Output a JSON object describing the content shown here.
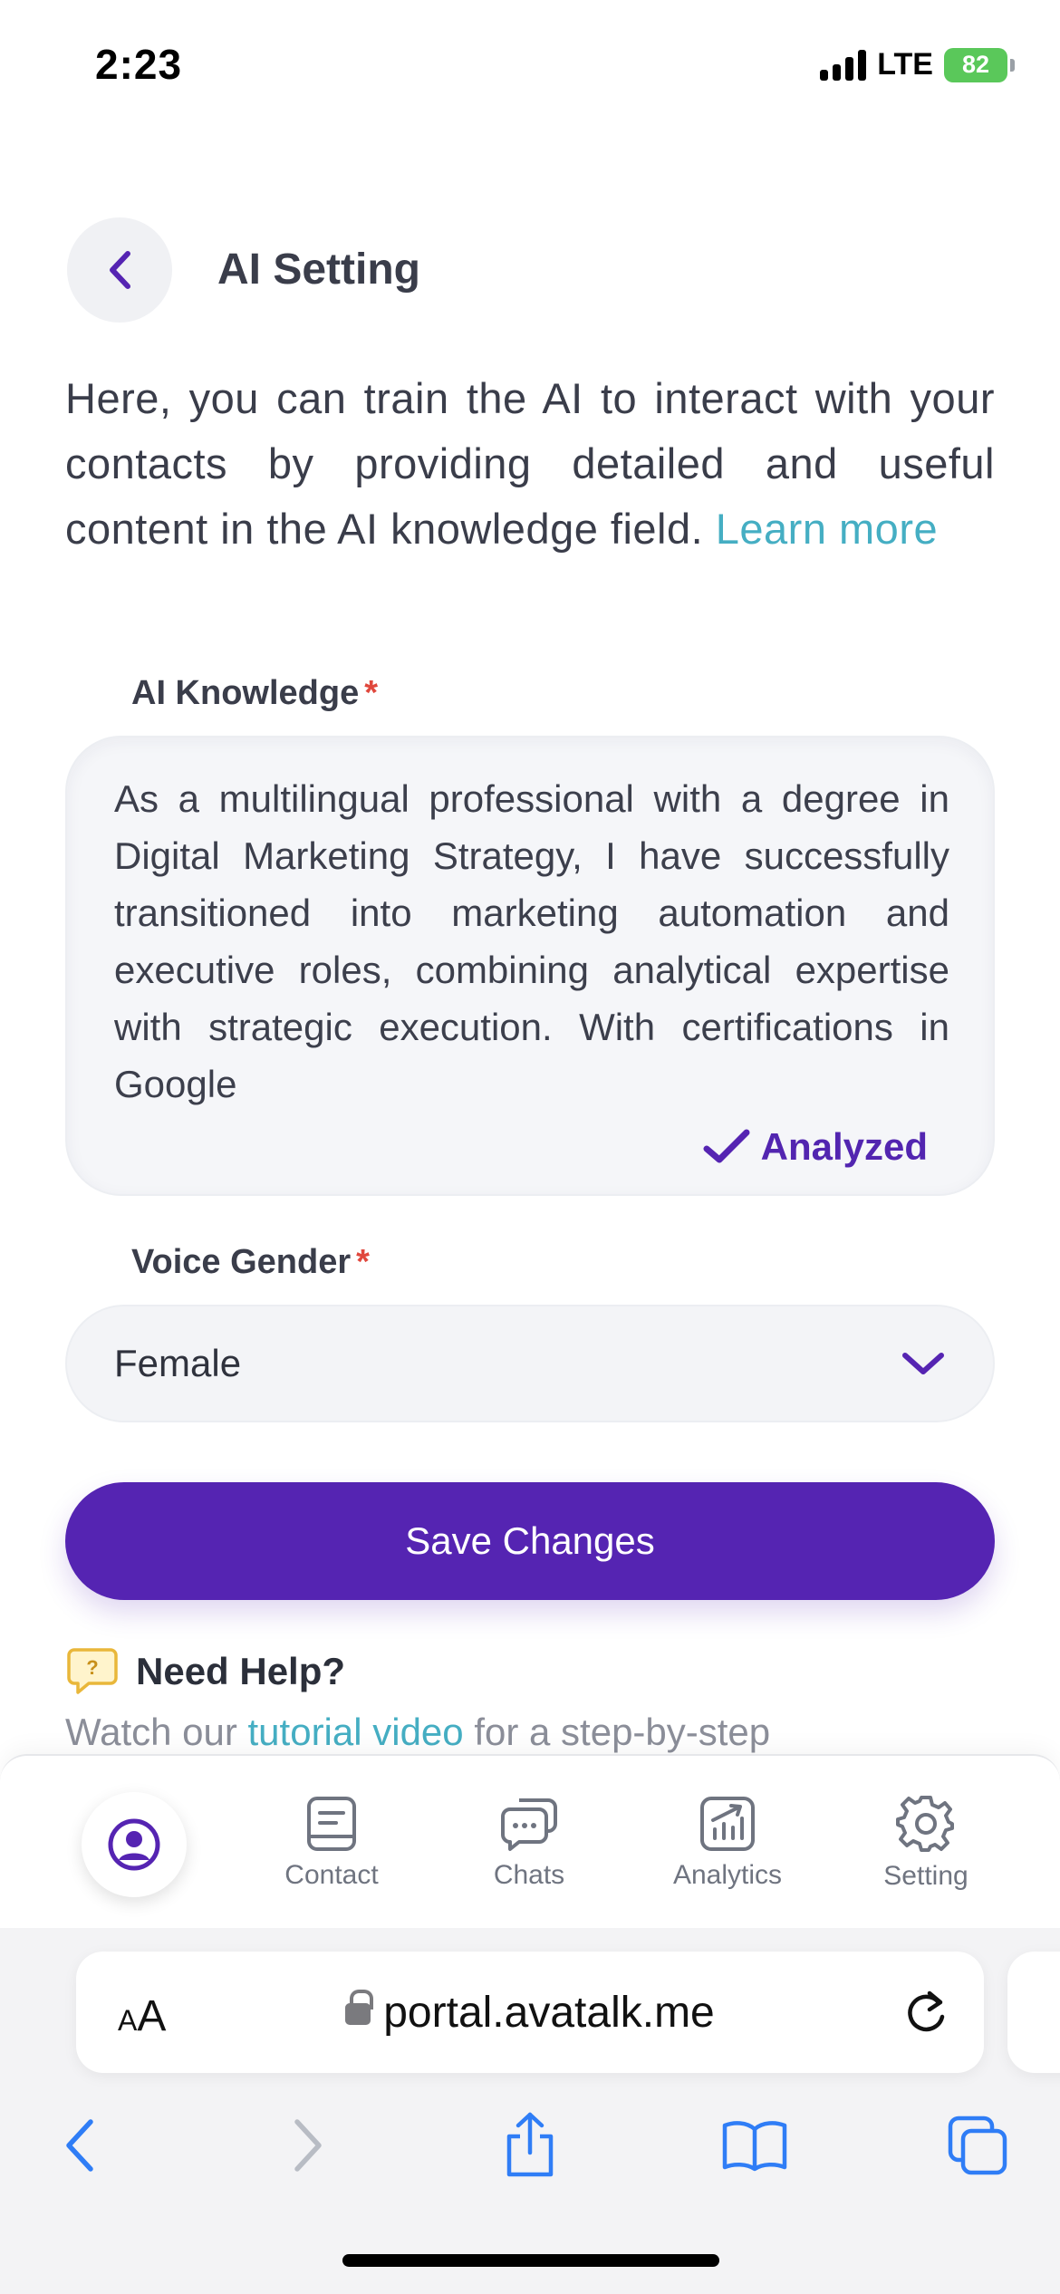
{
  "status_bar": {
    "time": "2:23",
    "network": "LTE",
    "battery": "82"
  },
  "header": {
    "title": "AI Setting"
  },
  "intro": {
    "text": "Here, you can train the AI to interact with your contacts by providing detailed and useful content in the AI knowledge field.",
    "link_label": "Learn more"
  },
  "knowledge": {
    "label": "AI Knowledge",
    "required_mark": "*",
    "value": "As a multilingual professional with a degree in Digital Marketing Strategy, I have successfully transitioned into marketing automation and executive roles, combining analytical expertise with strategic execution. With certifications in Google",
    "status": "Analyzed"
  },
  "voice_gender": {
    "label": "Voice Gender",
    "required_mark": "*",
    "selected": "Female"
  },
  "save_button": {
    "label": "Save Changes"
  },
  "help": {
    "title": "Need Help?",
    "text_before": "Watch our",
    "link_label": "tutorial video",
    "text_after": "for a step-by-step"
  },
  "tab_bar": {
    "items": [
      {
        "label": "",
        "icon": "profile-icon",
        "active": true
      },
      {
        "label": "Contact",
        "icon": "contact-icon"
      },
      {
        "label": "Chats",
        "icon": "chats-icon"
      },
      {
        "label": "Analytics",
        "icon": "analytics-icon"
      },
      {
        "label": "Setting",
        "icon": "setting-icon"
      }
    ]
  },
  "browser": {
    "text_size_label_small": "A",
    "text_size_label_large": "A",
    "url": "portal.avatalk.me"
  },
  "colors": {
    "primary": "#5524b2",
    "link": "#45aec3",
    "required": "#e0473c",
    "battery": "#5ac85a",
    "browser_blue": "#2f7df6"
  }
}
